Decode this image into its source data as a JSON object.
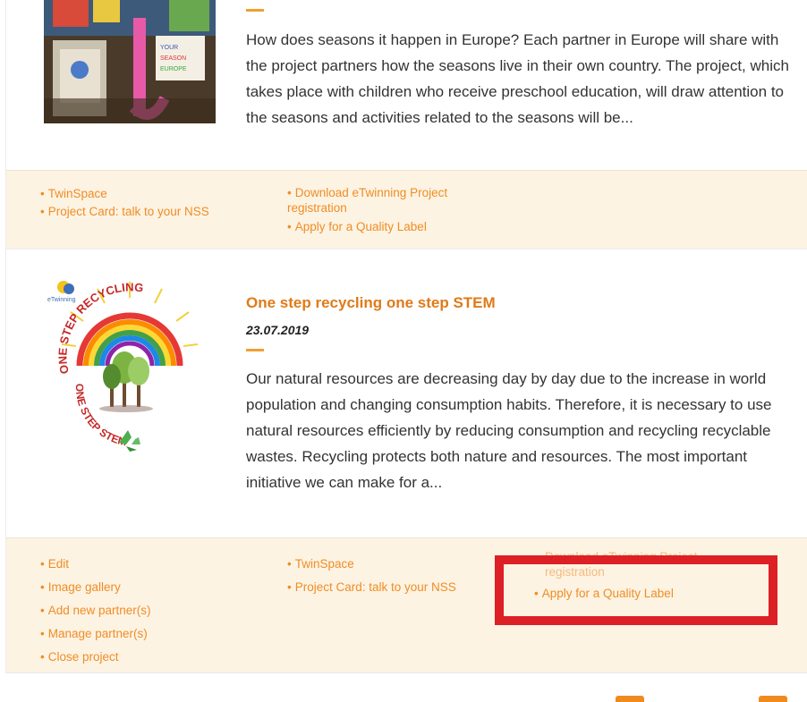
{
  "projects": [
    {
      "title": "",
      "date": "",
      "description": "How does seasons it happen in Europe? Each partner in Europe will share with the project partners how the seasons live in their own country. The project, which takes place with children who receive preschool education, will draw attention to the seasons and activities related to the seasons will be...",
      "links_col1": [
        "TwinSpace",
        "Project Card: talk to your NSS"
      ],
      "links_col2": [
        "Download eTwinning Project registration",
        "Apply for a Quality Label"
      ]
    },
    {
      "title": "One step recycling one step STEM",
      "date": "23.07.2019",
      "description": "Our natural resources are decreasing day by day due to the increase in world population and changing consumption habits. Therefore, it is necessary to use natural resources efficiently by reducing consumption and recycling recyclable wastes. Recycling protects both nature and resources. The most important initiative we can make for a...",
      "logo_text": {
        "top": "ONE STEP RECYCLING",
        "bottom": "ONE STEP STEM",
        "badge": "eTwinning"
      },
      "links_col1": [
        "Edit",
        "Image gallery",
        "Add new partner(s)",
        "Manage partner(s)",
        "Close project"
      ],
      "links_col2": [
        "TwinSpace",
        "Project Card: talk to your NSS"
      ],
      "links_col3": [
        "Download eTwinning Project registration",
        "Apply for a Quality Label"
      ]
    }
  ],
  "highlight_color": "#dd1f26",
  "accent_color": "#ef8d25"
}
